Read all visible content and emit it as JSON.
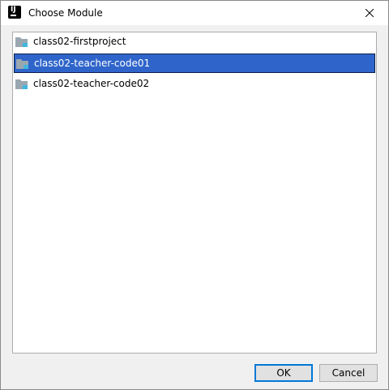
{
  "window": {
    "title": "Choose Module",
    "app_icon_text": "IJ"
  },
  "modules": [
    {
      "label": "class02-firstproject",
      "selected": false
    },
    {
      "label": "class02-teacher-code01",
      "selected": true
    },
    {
      "label": "class02-teacher-code02",
      "selected": false
    }
  ],
  "buttons": {
    "ok_label": "OK",
    "cancel_label": "Cancel"
  },
  "colors": {
    "selection": "#2f65ca",
    "folder_gray": "#9aa7b0",
    "module_marker": "#40b6e0"
  }
}
